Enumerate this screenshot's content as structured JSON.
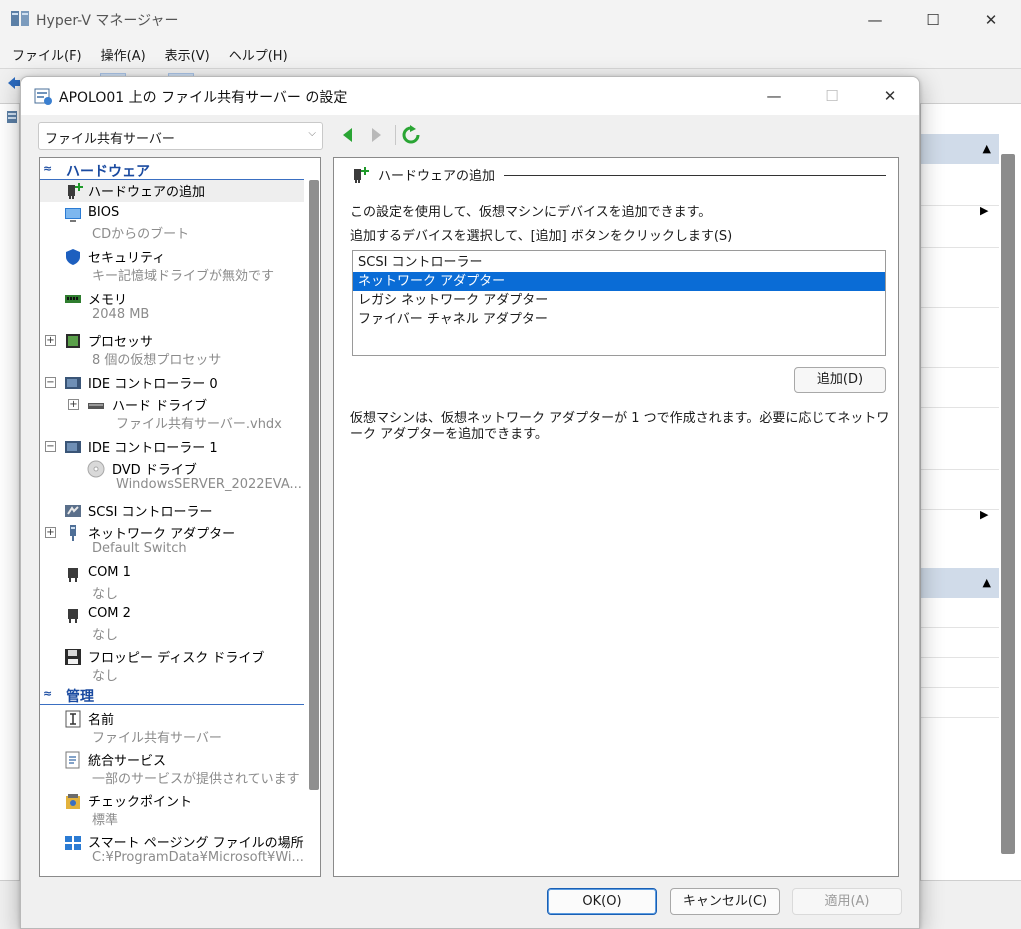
{
  "main_window": {
    "title": "Hyper-V マネージャー",
    "menu": [
      "ファイル(F)",
      "操作(A)",
      "表示(V)",
      "ヘルプ(H)"
    ],
    "minimize": "—",
    "maximize": "☐",
    "close": "✕"
  },
  "dialog": {
    "title": "APOLO01 上の ファイル共有サーバー の設定",
    "minimize": "—",
    "maximize": "☐",
    "close": "✕",
    "vm_selector": {
      "value": "ファイル共有サーバー",
      "chevron": "⌵"
    },
    "tree": {
      "hardware_section": "ハードウェア",
      "management_section": "管理",
      "section_chevron": "≈",
      "items": [
        {
          "name": "ハードウェアの追加",
          "sub": ""
        },
        {
          "name": "BIOS",
          "sub": "CDからのブート"
        },
        {
          "name": "セキュリティ",
          "sub": "キー記憶域ドライブが無効です"
        },
        {
          "name": "メモリ",
          "sub": "2048 MB"
        },
        {
          "name": "プロセッサ",
          "sub": "8 個の仮想プロセッサ"
        },
        {
          "name": "IDE コントローラー 0",
          "sub": ""
        },
        {
          "name": "ハード ドライブ",
          "sub": "ファイル共有サーバー.vhdx"
        },
        {
          "name": "IDE コントローラー 1",
          "sub": ""
        },
        {
          "name": "DVD ドライブ",
          "sub": "WindowsSERVER_2022EVA..."
        },
        {
          "name": "SCSI コントローラー",
          "sub": ""
        },
        {
          "name": "ネットワーク アダプター",
          "sub": "Default Switch"
        },
        {
          "name": "COM 1",
          "sub": "なし"
        },
        {
          "name": "COM 2",
          "sub": "なし"
        },
        {
          "name": "フロッピー ディスク ドライブ",
          "sub": "なし"
        },
        {
          "name": "名前",
          "sub": "ファイル共有サーバー"
        },
        {
          "name": "統合サービス",
          "sub": "一部のサービスが提供されています"
        },
        {
          "name": "チェックポイント",
          "sub": "標準"
        },
        {
          "name": "スマート ページング ファイルの場所",
          "sub": "C:¥ProgramData¥Microsoft¥Wi..."
        }
      ]
    },
    "panel": {
      "group_title": "ハードウェアの追加",
      "description": "この設定を使用して、仮想マシンにデバイスを追加できます。",
      "instruction": "追加するデバイスを選択して、[追加] ボタンをクリックします(S)",
      "devices": [
        "SCSI コントローラー",
        "ネットワーク アダプター",
        "レガシ ネットワーク アダプター",
        "ファイバー チャネル アダプター"
      ],
      "selected_device_index": 1,
      "add_button": "追加(D)",
      "note": "仮想マシンは、仮想ネットワーク アダプターが 1 つで作成されます。必要に応じてネットワーク アダプターを追加できます。"
    },
    "buttons": {
      "ok": "OK(O)",
      "cancel": "キャンセル(C)",
      "apply": "適用(A)"
    }
  },
  "colors": {
    "accent": "#0a6cd6",
    "section_heading": "#1a4aa0",
    "selected_row": "#eeeeee"
  }
}
